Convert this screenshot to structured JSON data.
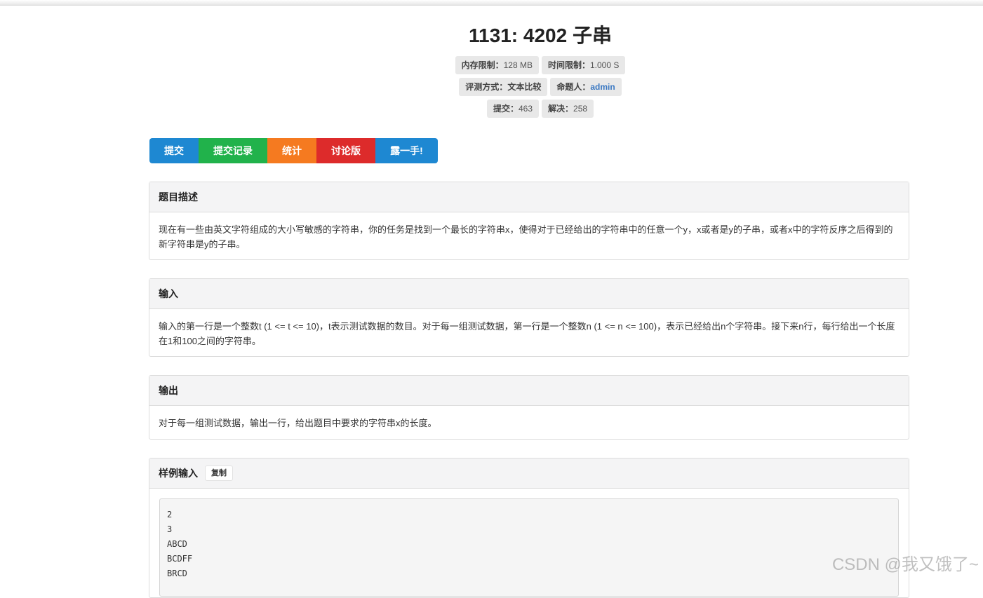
{
  "header": {
    "title": "1131: 4202 子串",
    "memory_label": "内存限制：",
    "memory_value": "128 MB",
    "time_label": "时间限制：",
    "time_value": "1.000 S",
    "judge_label": "评测方式：",
    "judge_value": "文本比较",
    "author_label": "命题人：",
    "author_value": "admin",
    "submit_label": "提交：",
    "submit_value": "463",
    "solved_label": "解决：",
    "solved_value": "258"
  },
  "buttons": {
    "submit": "提交",
    "records": "提交记录",
    "stats": "统计",
    "forum": "讨论版",
    "show": "露一手!"
  },
  "sections": {
    "description": {
      "title": "题目描述",
      "text": "现在有一些由英文字符组成的大小写敏感的字符串，你的任务是找到一个最长的字符串x，使得对于已经给出的字符串中的任意一个y，x或者是y的子串，或者x中的字符反序之后得到的新字符串是y的子串。"
    },
    "input": {
      "title": "输入",
      "text": "输入的第一行是一个整数t (1 <= t <= 10)，t表示测试数据的数目。对于每一组测试数据，第一行是一个整数n (1 <= n <= 100)，表示已经给出n个字符串。接下来n行，每行给出一个长度在1和100之间的字符串。"
    },
    "output": {
      "title": "输出",
      "text": "对于每一组测试数据，输出一行，给出题目中要求的字符串x的长度。"
    },
    "sample_input": {
      "title": "样例输入",
      "copy_label": "复制",
      "lines": [
        "2",
        "3",
        "ABCD",
        "BCDFF",
        "BRCD"
      ]
    }
  },
  "watermark": "CSDN @我又饿了~"
}
